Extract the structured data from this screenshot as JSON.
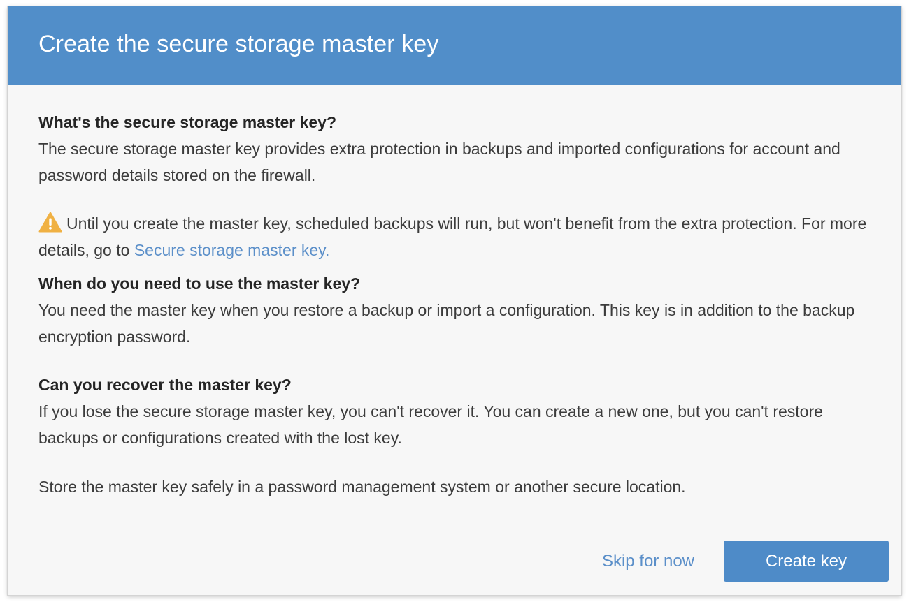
{
  "dialog": {
    "title": "Create the secure storage master key"
  },
  "sections": {
    "what": {
      "heading": "What's the secure storage master key?",
      "text": "The secure storage master key provides extra protection in backups and imported configurations for account and password details stored on the firewall."
    },
    "warning": {
      "icon": "warning-triangle-icon",
      "icon_color": "#f0b143",
      "text": "Until you create the master key, scheduled backups will run, but won't benefit from the extra protection. For more details, go to",
      "link_text": "Secure storage master key",
      "link_suffix": "."
    },
    "when": {
      "heading": "When do you need to use the master key?",
      "text": "You need the master key when you restore a backup or import a configuration. This key is in addition to the backup encryption password."
    },
    "recover": {
      "heading": "Can you recover the master key?",
      "text": "If you lose the secure storage master key, you can't recover it. You can create a new one, but you can't restore backups or configurations created with the lost key."
    },
    "store_note": "Store the master key safely in a password management system or another secure location."
  },
  "footer": {
    "skip_label": "Skip for now",
    "create_label": "Create key"
  },
  "colors": {
    "header_bg": "#518ec9",
    "primary_button": "#4e8bc8",
    "link": "#5b8fc9"
  }
}
